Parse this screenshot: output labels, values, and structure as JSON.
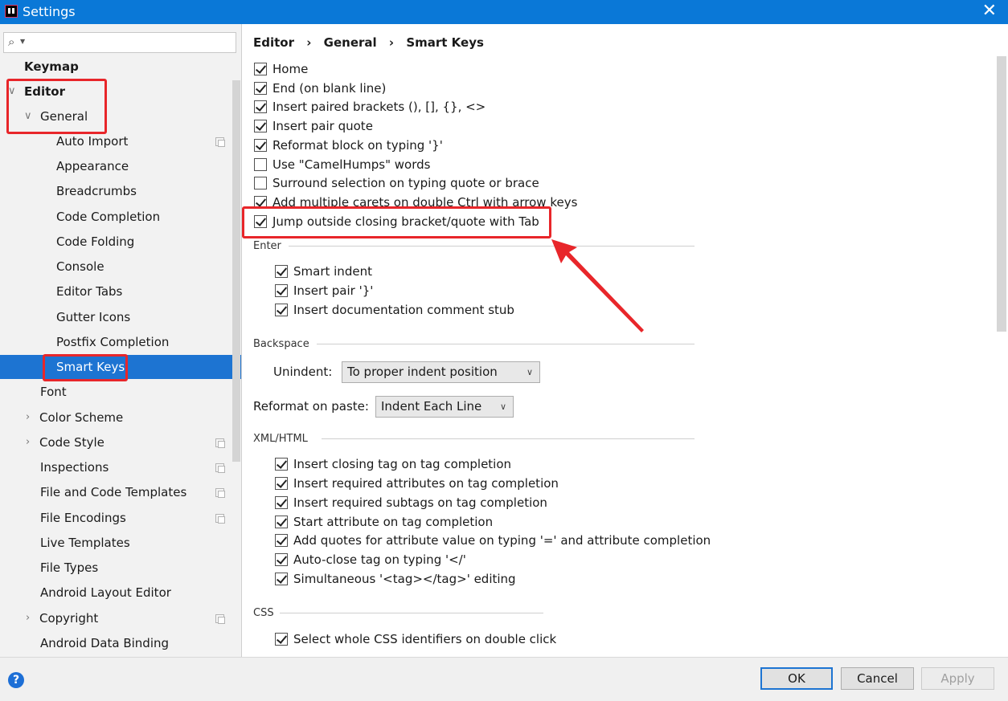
{
  "window": {
    "title": "Settings",
    "close_glyph": "✕",
    "icon": "intellij-icon"
  },
  "sidebar": {
    "search": {
      "value": "",
      "placeholder": ""
    },
    "items": [
      {
        "label": "Keymap",
        "bold": true
      },
      {
        "label": "Editor",
        "bold": true,
        "expanded": true
      },
      {
        "label": "General",
        "expanded": true
      },
      {
        "label": "Auto Import"
      },
      {
        "label": "Appearance"
      },
      {
        "label": "Breadcrumbs"
      },
      {
        "label": "Code Completion"
      },
      {
        "label": "Code Folding"
      },
      {
        "label": "Console"
      },
      {
        "label": "Editor Tabs"
      },
      {
        "label": "Gutter Icons"
      },
      {
        "label": "Postfix Completion"
      },
      {
        "label": "Smart Keys",
        "selected": true
      },
      {
        "label": "Font"
      },
      {
        "label": "Color Scheme"
      },
      {
        "label": "Code Style"
      },
      {
        "label": "Inspections"
      },
      {
        "label": "File and Code Templates"
      },
      {
        "label": "File Encodings"
      },
      {
        "label": "Live Templates"
      },
      {
        "label": "File Types"
      },
      {
        "label": "Android Layout Editor"
      },
      {
        "label": "Copyright"
      },
      {
        "label": "Android Data Binding"
      }
    ]
  },
  "breadcrumb": [
    "Editor",
    "General",
    "Smart Keys"
  ],
  "breadcrumb_sep": "›",
  "options": {
    "top": [
      {
        "label": "Home",
        "checked": true
      },
      {
        "label": "End (on blank line)",
        "checked": true
      },
      {
        "label": "Insert paired brackets (), [], {}, <>",
        "checked": true
      },
      {
        "label": "Insert pair quote",
        "checked": true
      },
      {
        "label": "Reformat block on typing '}'",
        "checked": true
      },
      {
        "label": "Use \"CamelHumps\" words",
        "checked": false
      },
      {
        "label": "Surround selection on typing quote or brace",
        "checked": false
      },
      {
        "label": "Add multiple carets on double Ctrl with arrow keys",
        "checked": true
      },
      {
        "label": "Jump outside closing bracket/quote with Tab",
        "checked": true
      }
    ],
    "enter_title": "Enter",
    "enter": [
      {
        "label": "Smart indent",
        "checked": true
      },
      {
        "label": "Insert pair '}'",
        "checked": true
      },
      {
        "label": "Insert documentation comment stub",
        "checked": true
      }
    ],
    "backspace_title": "Backspace",
    "unindent_label": "Unindent:",
    "unindent_value": "To proper indent position",
    "reformat_label": "Reformat on paste:",
    "reformat_value": "Indent Each Line",
    "xml_title": "XML/HTML",
    "xml": [
      {
        "label": "Insert closing tag on tag completion",
        "checked": true
      },
      {
        "label": "Insert required attributes on tag completion",
        "checked": true
      },
      {
        "label": "Insert required subtags on tag completion",
        "checked": true
      },
      {
        "label": "Start attribute on tag completion",
        "checked": true
      },
      {
        "label": "Add quotes for attribute value on typing '=' and attribute completion",
        "checked": true
      },
      {
        "label": "Auto-close tag on typing '</'",
        "checked": true
      },
      {
        "label": "Simultaneous '<tag></tag>' editing",
        "checked": true
      }
    ],
    "css_title": "CSS",
    "css": [
      {
        "label": "Select whole CSS identifiers on double click",
        "checked": true
      }
    ]
  },
  "footer": {
    "help": "?",
    "ok": "OK",
    "cancel": "Cancel",
    "apply": "Apply"
  },
  "colors": {
    "accent": "#1d74d2",
    "titlebar": "#0a78d7",
    "annotation": "#e8262a"
  }
}
